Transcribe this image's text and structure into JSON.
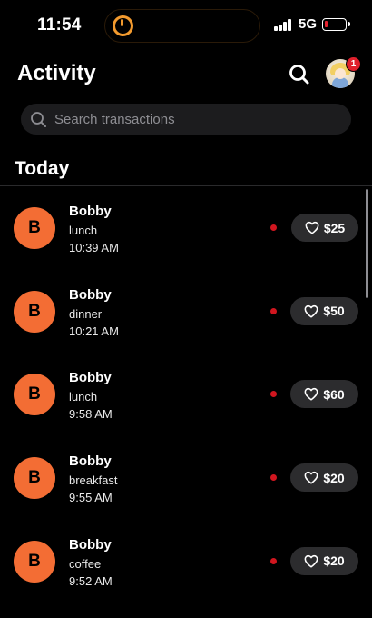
{
  "status_bar": {
    "time": "11:54",
    "network": "5G",
    "battery_level": 0.15,
    "battery_color": "#e5232f",
    "timer_color": "#f29a2e"
  },
  "header": {
    "title": "Activity",
    "search_icon": "search-icon",
    "avatar_badge": "1"
  },
  "search": {
    "placeholder": "Search transactions",
    "value": ""
  },
  "section": {
    "title": "Today"
  },
  "accent_color": "#f36d34",
  "transactions": [
    {
      "initial": "B",
      "name": "Bobby",
      "description": "lunch",
      "time": "10:39 AM",
      "amount": "$25",
      "unread": true
    },
    {
      "initial": "B",
      "name": "Bobby",
      "description": "dinner",
      "time": "10:21 AM",
      "amount": "$50",
      "unread": true
    },
    {
      "initial": "B",
      "name": "Bobby",
      "description": "lunch",
      "time": "9:58 AM",
      "amount": "$60",
      "unread": true
    },
    {
      "initial": "B",
      "name": "Bobby",
      "description": "breakfast",
      "time": "9:55 AM",
      "amount": "$20",
      "unread": true
    },
    {
      "initial": "B",
      "name": "Bobby",
      "description": "coffee",
      "time": "9:52 AM",
      "amount": "$20",
      "unread": true
    }
  ]
}
